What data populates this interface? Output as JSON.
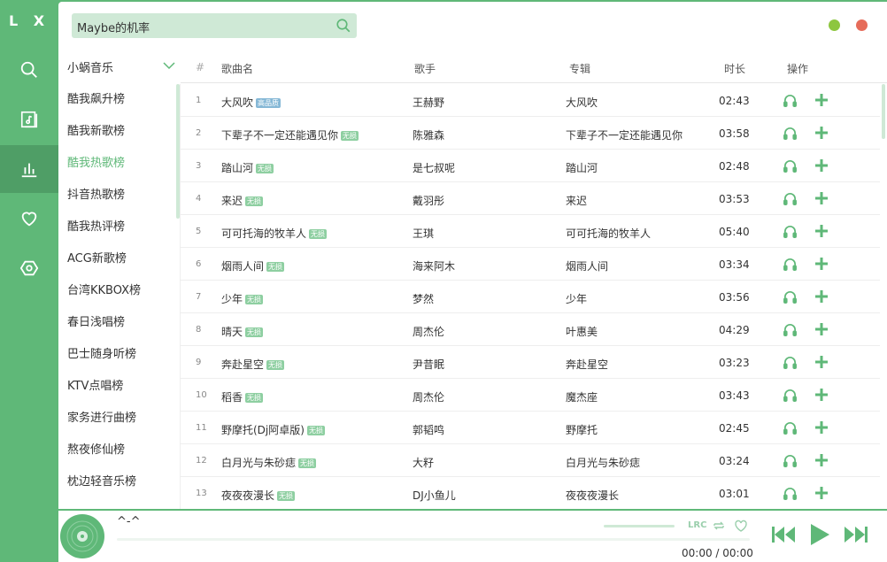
{
  "app": {
    "logo": "L X"
  },
  "nav": [
    {
      "name": "search",
      "icon": "search-icon"
    },
    {
      "name": "playlist",
      "icon": "music-file-icon"
    },
    {
      "name": "leaderboard",
      "icon": "bar-chart-icon",
      "active": true
    },
    {
      "name": "favorites",
      "icon": "heart-icon"
    },
    {
      "name": "settings",
      "icon": "gear-icon"
    }
  ],
  "search": {
    "value": "Maybe的机率"
  },
  "source": {
    "selected": "小蜗音乐"
  },
  "columns": {
    "num": "#",
    "name": "歌曲名",
    "artist": "歌手",
    "album": "专辑",
    "duration": "时长",
    "actions": "操作"
  },
  "boards": [
    {
      "label": "酷我飙升榜"
    },
    {
      "label": "酷我新歌榜"
    },
    {
      "label": "酷我热歌榜",
      "active": true
    },
    {
      "label": "抖音热歌榜"
    },
    {
      "label": "酷我热评榜"
    },
    {
      "label": "ACG新歌榜"
    },
    {
      "label": "台湾KKBOX榜"
    },
    {
      "label": "春日浅唱榜"
    },
    {
      "label": "巴士随身听榜"
    },
    {
      "label": "KTV点唱榜"
    },
    {
      "label": "家务进行曲榜"
    },
    {
      "label": "熬夜修仙榜"
    },
    {
      "label": "枕边轻音乐榜"
    }
  ],
  "songs": [
    {
      "num": "1",
      "name": "大风吹",
      "tag": "高品质",
      "tag_color": "blue",
      "artist": "王赫野",
      "album": "大风吹",
      "duration": "02:43"
    },
    {
      "num": "2",
      "name": "下辈子不一定还能遇见你",
      "tag": "无损",
      "tag_color": "green",
      "artist": "陈雅森",
      "album": "下辈子不一定还能遇见你",
      "duration": "03:58"
    },
    {
      "num": "3",
      "name": "踏山河",
      "tag": "无损",
      "tag_color": "green",
      "artist": "是七叔呢",
      "album": "踏山河",
      "duration": "02:48"
    },
    {
      "num": "4",
      "name": "来迟",
      "tag": "无损",
      "tag_color": "green",
      "artist": "戴羽彤",
      "album": "来迟",
      "duration": "03:53"
    },
    {
      "num": "5",
      "name": "可可托海的牧羊人",
      "tag": "无损",
      "tag_color": "green",
      "artist": "王琪",
      "album": "可可托海的牧羊人",
      "duration": "05:40"
    },
    {
      "num": "6",
      "name": "烟雨人间",
      "tag": "无损",
      "tag_color": "green",
      "artist": "海来阿木",
      "album": "烟雨人间",
      "duration": "03:34"
    },
    {
      "num": "7",
      "name": "少年",
      "tag": "无损",
      "tag_color": "green",
      "artist": "梦然",
      "album": "少年",
      "duration": "03:56"
    },
    {
      "num": "8",
      "name": "晴天",
      "tag": "无损",
      "tag_color": "green",
      "artist": "周杰伦",
      "album": "叶惠美",
      "duration": "04:29"
    },
    {
      "num": "9",
      "name": "奔赴星空",
      "tag": "无损",
      "tag_color": "green",
      "artist": "尹昔眠",
      "album": "奔赴星空",
      "duration": "03:23"
    },
    {
      "num": "10",
      "name": "稻香",
      "tag": "无损",
      "tag_color": "green",
      "artist": "周杰伦",
      "album": "魔杰座",
      "duration": "03:43"
    },
    {
      "num": "11",
      "name": "野摩托(Dj阿卓版)",
      "tag": "无损",
      "tag_color": "green",
      "artist": "郭韬鸣",
      "album": "野摩托",
      "duration": "02:45"
    },
    {
      "num": "12",
      "name": "白月光与朱砂痣",
      "tag": "无损",
      "tag_color": "green",
      "artist": "大籽",
      "album": "白月光与朱砂痣",
      "duration": "03:24"
    },
    {
      "num": "13",
      "name": "夜夜夜漫长",
      "tag": "无损",
      "tag_color": "green",
      "artist": "DJ小鱼儿",
      "album": "夜夜夜漫长",
      "duration": "03:01"
    }
  ],
  "player": {
    "title": "^-^",
    "lrc_label": "LRC",
    "time": "00:00 / 00:00",
    "progress": 0
  },
  "colors": {
    "accent": "#5fb878",
    "accent_dark": "#4f9e66",
    "accent_light": "#cfe9d6",
    "min": "#8dc63f",
    "close": "#e66c5a"
  }
}
